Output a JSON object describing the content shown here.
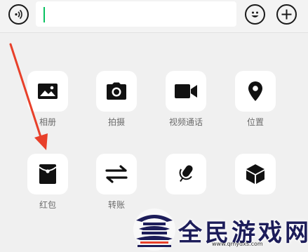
{
  "input_bar": {
    "voice_icon": "voice-input-icon",
    "emoji_icon": "emoji-smile-icon",
    "plus_icon": "plus-circle-icon",
    "value": ""
  },
  "panel": {
    "items": [
      {
        "label": "相册",
        "icon": "image-icon"
      },
      {
        "label": "拍摄",
        "icon": "camera-icon"
      },
      {
        "label": "视频通话",
        "icon": "video-call-icon"
      },
      {
        "label": "位置",
        "icon": "location-pin-icon"
      },
      {
        "label": "红包",
        "icon": "red-packet-icon"
      },
      {
        "label": "转账",
        "icon": "transfer-icon"
      },
      {
        "label": "",
        "icon": "microphone-icon"
      },
      {
        "label": "",
        "icon": "cube-icon"
      }
    ]
  },
  "colors": {
    "accent": "#07c160",
    "annotation_arrow": "#e8402a",
    "icon": "#111111"
  },
  "watermark": {
    "title": "全民游戏网",
    "url": "www.qmydxs.com"
  }
}
